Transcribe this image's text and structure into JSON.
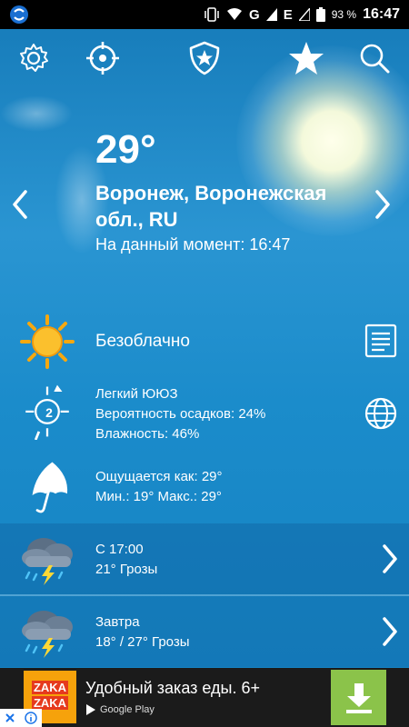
{
  "status_bar": {
    "battery": "93 %",
    "clock": "16:47",
    "network_g": "G",
    "network_e": "E"
  },
  "weather": {
    "temperature": "29°",
    "location": "Воронеж, Воронежская обл., RU",
    "observed_label": "На данный момент:",
    "observed_time": "16:47",
    "condition": "Безоблачно"
  },
  "wind": {
    "speed": "2",
    "description": "Легкий ЮЮЗ",
    "precip": "Вероятность осадков: 24%",
    "humidity": "Влажность: 46%"
  },
  "feels": {
    "feels_like": "Ощущается как: 29°",
    "min_max": "Мин.: 19° Макс.: 29°"
  },
  "forecast": [
    {
      "title": "С 17:00",
      "summary": "21° Грозы"
    },
    {
      "title": "Завтра",
      "summary": "18° / 27° Грозы"
    }
  ],
  "ad": {
    "logo_line1": "ZAKA",
    "logo_line2": "ZAKA",
    "title": "Удобный заказ еды. 6+",
    "store": "Google Play"
  },
  "colors": {
    "sky": "#2a95d2",
    "ad_download": "#8bc34a",
    "ad_logo": "#f6a20b"
  }
}
